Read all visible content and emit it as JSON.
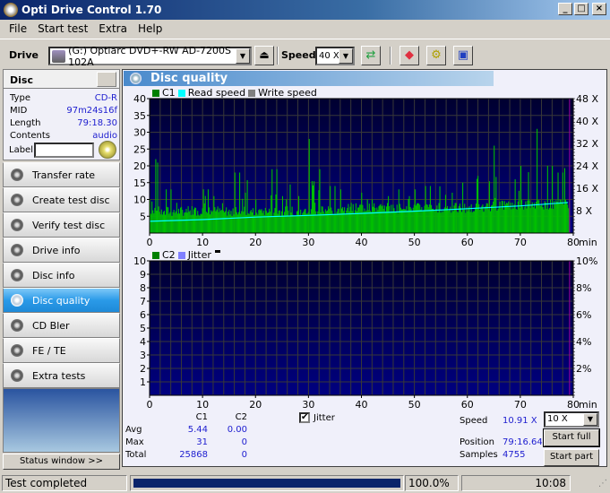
{
  "window": {
    "title": "Opti Drive Control 1.70",
    "controls": [
      "minimize-icon",
      "maximize-icon",
      "close-icon"
    ]
  },
  "menu": [
    "File",
    "Start test",
    "Extra",
    "Help"
  ],
  "toolbar": {
    "drive_label": "Drive",
    "drive_value": "(G:)   Optiarc DVD+-RW AD-7200S 102A",
    "speed_label": "Speed",
    "speed_value": "40 X",
    "icons": [
      "eject-icon",
      "refresh-icon",
      "erase-icon",
      "settings-icon",
      "save-icon"
    ]
  },
  "disc": {
    "header": "Disc",
    "fields": [
      {
        "key": "Type",
        "value": "CD-R"
      },
      {
        "key": "MID",
        "value": "97m24s16f"
      },
      {
        "key": "Length",
        "value": "79:18.30"
      },
      {
        "key": "Contents",
        "value": "audio"
      }
    ],
    "label_key": "Label",
    "label_value": ""
  },
  "nav": [
    {
      "label": "Transfer rate",
      "active": false
    },
    {
      "label": "Create test disc",
      "active": false
    },
    {
      "label": "Verify test disc",
      "active": false
    },
    {
      "label": "Drive info",
      "active": false
    },
    {
      "label": "Disc info",
      "active": false
    },
    {
      "label": "Disc quality",
      "active": true
    },
    {
      "label": "CD Bler",
      "active": false
    },
    {
      "label": "FE / TE",
      "active": false
    },
    {
      "label": "Extra tests",
      "active": false
    }
  ],
  "status_window_button": "Status window >>",
  "panel": {
    "title": "Disc quality"
  },
  "colors": {
    "c1": "#00c000",
    "read_speed": "#00ffff",
    "write_speed": "#808080",
    "c2": "#008000",
    "jitter": "#8080ff",
    "plot_bg_top": "#000030",
    "plot_bg_bottom": "#000080",
    "progress": "#0a246a",
    "value_text": "#2020d0"
  },
  "chart_data": [
    {
      "type": "bar",
      "title": "C1 / Read speed",
      "legend": [
        "C1",
        "Read speed",
        "Write speed"
      ],
      "xlabel": "min",
      "xlim": [
        0,
        80
      ],
      "ylim": [
        0,
        40
      ],
      "x_ticks": [
        "0",
        "10",
        "20",
        "30",
        "40",
        "50",
        "60",
        "70",
        "80"
      ],
      "y_ticks": [
        "5",
        "10",
        "15",
        "20",
        "25",
        "30",
        "35",
        "40"
      ],
      "y2_ticks": [
        "8 X",
        "16 X",
        "24 X",
        "32 X",
        "40 X",
        "48 X"
      ],
      "y2lim": [
        0,
        48
      ],
      "end_marker_min": 79.3,
      "c1_envelope": {
        "x": [
          0,
          1,
          2,
          3,
          4,
          5,
          6,
          7,
          8,
          9,
          10,
          11,
          12,
          13,
          14,
          15,
          16,
          17,
          18,
          19,
          20,
          21,
          22,
          23,
          24,
          25,
          26,
          27,
          28,
          29,
          30,
          31,
          32,
          33,
          34,
          35,
          36,
          37,
          38,
          39,
          40,
          41,
          42,
          43,
          44,
          45,
          46,
          47,
          48,
          49,
          50,
          51,
          52,
          53,
          54,
          55,
          56,
          57,
          58,
          59,
          60,
          61,
          62,
          63,
          64,
          65,
          66,
          67,
          68,
          69,
          70,
          71,
          72,
          73,
          74,
          75,
          76,
          77,
          78,
          79
        ],
        "y": [
          10,
          22,
          15,
          13,
          7,
          9,
          20,
          8,
          14,
          7,
          13,
          8,
          11,
          9,
          10,
          11,
          18,
          12,
          25,
          10,
          22,
          17,
          12,
          19,
          9,
          11,
          20,
          13,
          11,
          15,
          28,
          13,
          19,
          8,
          14,
          13,
          10,
          9,
          11,
          12,
          11,
          10,
          12,
          13,
          11,
          14,
          13,
          12,
          11,
          16,
          13,
          12,
          14,
          11,
          16,
          13,
          13,
          12,
          14,
          15,
          15,
          17,
          18,
          22,
          26,
          18,
          16,
          17,
          16,
          19,
          20,
          20,
          19,
          31,
          24,
          20,
          19,
          18,
          21,
          22
        ]
      },
      "c1_base": {
        "x": [
          0,
          10,
          20,
          30,
          40,
          50,
          60,
          70,
          79
        ],
        "y": [
          5,
          5,
          5,
          5,
          6,
          6,
          6,
          7,
          7
        ]
      },
      "read_speed_x": {
        "x": [
          0,
          10,
          20,
          30,
          40,
          50,
          60,
          70,
          79
        ],
        "y": [
          4.2,
          4.8,
          5.7,
          6.3,
          7,
          7.8,
          8.7,
          9.7,
          10.9
        ]
      }
    },
    {
      "type": "bar",
      "title": "C2 / Jitter",
      "legend": [
        "C2",
        "Jitter"
      ],
      "xlabel": "min",
      "xlim": [
        0,
        80
      ],
      "ylim": [
        0,
        10
      ],
      "x_ticks": [
        "0",
        "10",
        "20",
        "30",
        "40",
        "50",
        "60",
        "70",
        "80"
      ],
      "y_ticks": [
        "1",
        "2",
        "3",
        "4",
        "5",
        "6",
        "7",
        "8",
        "9",
        "10"
      ],
      "y2_ticks": [
        "2%",
        "4%",
        "6%",
        "8%",
        "10%"
      ],
      "y2lim": [
        0,
        10
      ],
      "end_marker_min": 79.3,
      "c2": {
        "x": [
          0,
          79
        ],
        "y": [
          0,
          0
        ]
      }
    }
  ],
  "stats": {
    "col_c1": "C1",
    "col_c2": "C2",
    "rows": [
      {
        "key": "Avg",
        "c1": "5.44",
        "c2": "0.00"
      },
      {
        "key": "Max",
        "c1": "31",
        "c2": "0"
      },
      {
        "key": "Total",
        "c1": "25868",
        "c2": "0"
      }
    ],
    "jitter_label": "Jitter",
    "jitter_checked": true
  },
  "readout": {
    "speed_key": "Speed",
    "speed_value": "10.91 X",
    "position_key": "Position",
    "position_value": "79:16.64",
    "samples_key": "Samples",
    "samples_value": "4755",
    "speed_select": "10 X",
    "start_full": "Start full",
    "start_part": "Start part"
  },
  "statusbar": {
    "message": "Test completed",
    "progress_percent": 100.0,
    "progress_text": "100.0%",
    "time": "10:08"
  }
}
